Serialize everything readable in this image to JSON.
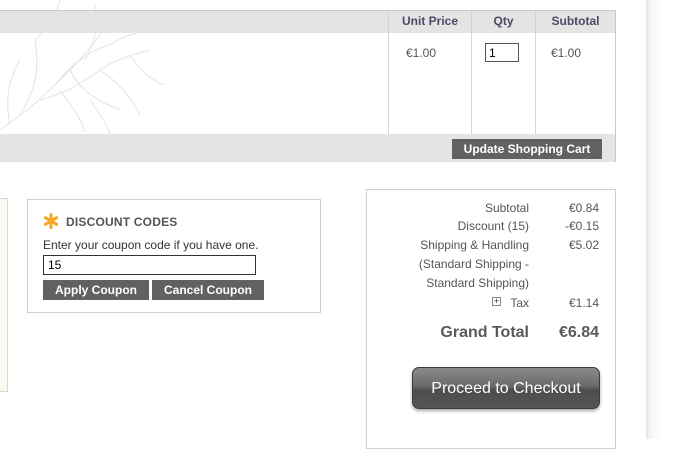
{
  "cart": {
    "headers": {
      "unit_price": "Unit Price",
      "qty": "Qty",
      "subtotal": "Subtotal"
    },
    "row": {
      "unit_price": "€1.00",
      "qty": "1",
      "subtotal": "€1.00"
    },
    "update_label": "Update Shopping Cart"
  },
  "discount": {
    "title": "DISCOUNT CODES",
    "label": "Enter your coupon code if you have one.",
    "code": "15",
    "apply_label": "Apply Coupon",
    "cancel_label": "Cancel Coupon"
  },
  "totals": {
    "subtotal_label": "Subtotal",
    "subtotal_value": "€0.84",
    "discount_label": "Discount (15)",
    "discount_value": "-€0.15",
    "shipping_label_1": "Shipping & Handling",
    "shipping_label_2": "(Standard Shipping -",
    "shipping_label_3": "Standard Shipping)",
    "shipping_value": "€5.02",
    "tax_toggle": "+",
    "tax_label": "Tax",
    "tax_value": "€1.14",
    "grand_total_label": "Grand Total",
    "grand_total_value": "€6.84",
    "checkout_label": "Proceed to Checkout"
  },
  "colors": {
    "button_dark": "#616161",
    "discount_icon": "#f5a623",
    "header_bg": "#e4e4e4"
  }
}
